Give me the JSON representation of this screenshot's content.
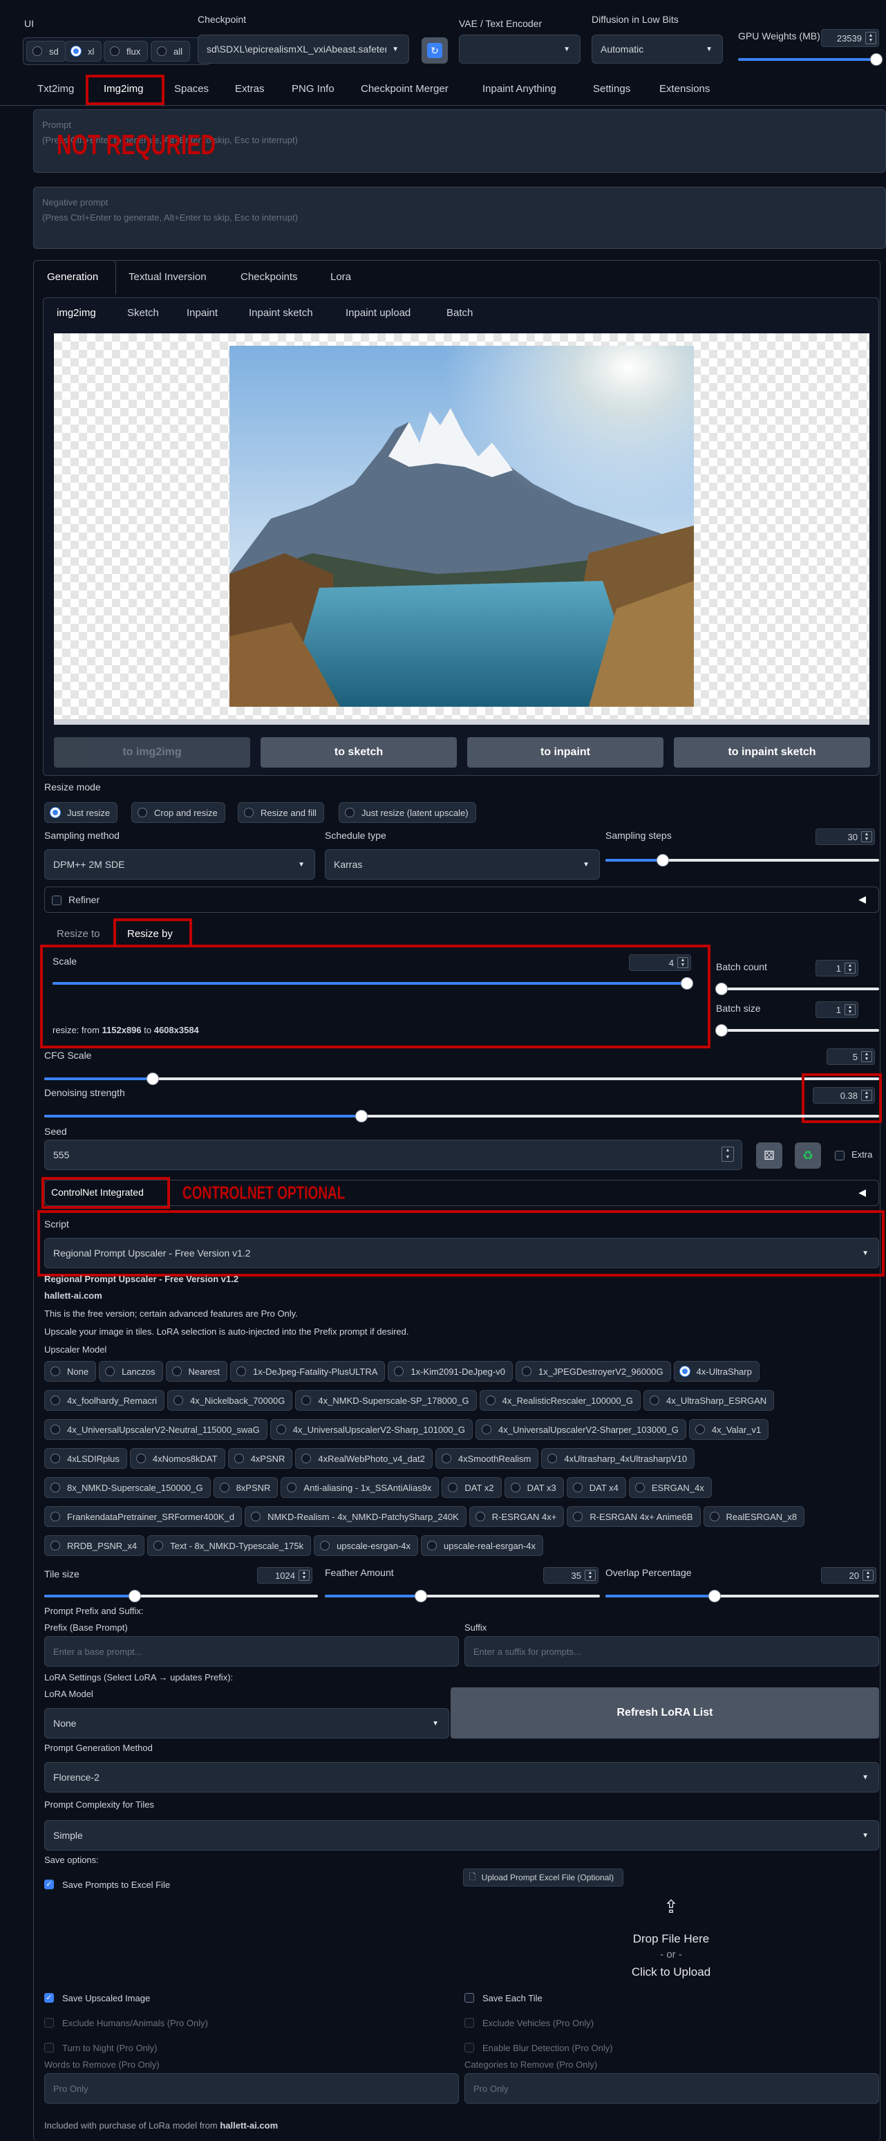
{
  "header": {
    "ui_label": "UI",
    "ui_options": [
      "sd",
      "xl",
      "flux",
      "all"
    ],
    "ui_selected": "xl",
    "checkpoint_label": "Checkpoint",
    "checkpoint_value": "sd\\SDXL\\epicrealismXL_vxiAbeast.safetensors",
    "vae_label": "VAE / Text Encoder",
    "vae_value": "",
    "diffusion_label": "Diffusion in Low Bits",
    "diffusion_value": "Automatic",
    "gpu_label": "GPU Weights (MB)",
    "gpu_value": "23539"
  },
  "main_tabs": [
    "Txt2img",
    "Img2img",
    "Spaces",
    "Extras",
    "PNG Info",
    "Checkpoint Merger",
    "Inpaint Anything",
    "Settings",
    "Extensions"
  ],
  "main_tab_active": "Img2img",
  "prompt": {
    "label": "Prompt",
    "placeholder": "(Press Ctrl+Enter to generate, Alt+Enter to skip, Esc to interrupt)"
  },
  "negative_prompt": {
    "label": "Negative prompt",
    "placeholder": "(Press Ctrl+Enter to generate, Alt+Enter to skip, Esc to interrupt)"
  },
  "gen_tabs": [
    "Generation",
    "Textual Inversion",
    "Checkpoints",
    "Lora"
  ],
  "img_tabs": [
    "img2img",
    "Sketch",
    "Inpaint",
    "Inpaint sketch",
    "Inpaint upload",
    "Batch"
  ],
  "send_buttons": [
    "to img2img",
    "to sketch",
    "to inpaint",
    "to inpaint sketch"
  ],
  "resize_mode": {
    "label": "Resize mode",
    "options": [
      "Just resize",
      "Crop and resize",
      "Resize and fill",
      "Just resize (latent upscale)"
    ],
    "selected": "Just resize"
  },
  "sampling": {
    "method_label": "Sampling method",
    "method_value": "DPM++ 2M SDE",
    "schedule_label": "Schedule type",
    "schedule_value": "Karras",
    "steps_label": "Sampling steps",
    "steps_value": "30"
  },
  "refiner_label": "Refiner",
  "resize_tabs": [
    "Resize to",
    "Resize by"
  ],
  "scale": {
    "label": "Scale",
    "value": "4",
    "info_prefix": "resize: from ",
    "from": "1152x896",
    "to_word": " to ",
    "to": "4608x3584",
    "level": 1.0
  },
  "batch_count": {
    "label": "Batch count",
    "value": "1"
  },
  "batch_size": {
    "label": "Batch size",
    "value": "1"
  },
  "cfg": {
    "label": "CFG Scale",
    "value": "5",
    "level": 0.13
  },
  "denoise": {
    "label": "Denoising strength",
    "value": "0.38",
    "level": 0.38
  },
  "seed": {
    "label": "Seed",
    "value": "555",
    "extra_label": "Extra"
  },
  "controlnet_label": "ControlNet Integrated",
  "script": {
    "label": "Script",
    "value": "Regional Prompt Upscaler - Free Version v1.2"
  },
  "rpu": {
    "title": "Regional Prompt Upscaler - Free Version v1.2",
    "site": "hallett-ai.com",
    "line1": "This is the free version; certain advanced features are Pro Only.",
    "line2": "Upscale your image in tiles. LoRA selection is auto-injected into the Prefix prompt if desired.",
    "upscaler_label": "Upscaler Model",
    "upscalers": [
      [
        "None",
        "Lanczos",
        "Nearest",
        "1x-DeJpeg-Fatality-PlusULTRA",
        "1x-Kim2091-DeJpeg-v0",
        "1x_JPEGDestroyerV2_96000G",
        "4x-UltraSharp"
      ],
      [
        "4x_foolhardy_Remacri",
        "4x_Nickelback_70000G",
        "4x_NMKD-Superscale-SP_178000_G",
        "4x_RealisticRescaler_100000_G",
        "4x_UltraSharp_ESRGAN"
      ],
      [
        "4x_UniversalUpscalerV2-Neutral_115000_swaG",
        "4x_UniversalUpscalerV2-Sharp_101000_G",
        "4x_UniversalUpscalerV2-Sharper_103000_G",
        "4x_Valar_v1"
      ],
      [
        "4xLSDIRplus",
        "4xNomos8kDAT",
        "4xPSNR",
        "4xRealWebPhoto_v4_dat2",
        "4xSmoothRealism",
        "4xUltrasharp_4xUltrasharpV10"
      ],
      [
        "8x_NMKD-Superscale_150000_G",
        "8xPSNR",
        "Anti-aliasing - 1x_SSAntiAlias9x",
        "DAT x2",
        "DAT x3",
        "DAT x4",
        "ESRGAN_4x"
      ],
      [
        "FrankendataPretrainer_SRFormer400K_d",
        "NMKD-Realism - 4x_NMKD-PatchySharp_240K",
        "R-ESRGAN 4x+",
        "R-ESRGAN 4x+ Anime6B",
        "RealESRGAN_x8"
      ],
      [
        "RRDB_PSNR_x4",
        "Text - 8x_NMKD-Typescale_175k",
        "upscale-esrgan-4x",
        "upscale-real-esrgan-4x"
      ]
    ],
    "upscaler_selected": "4x-UltraSharp",
    "tile_label": "Tile size",
    "tile_value": "1024",
    "tile_level": 0.33,
    "feather_label": "Feather Amount",
    "feather_value": "35",
    "feather_level": 0.35,
    "overlap_label": "Overlap Percentage",
    "overlap_value": "20",
    "overlap_level": 0.4,
    "prefix_suffix_label": "Prompt Prefix and Suffix:",
    "prefix_label": "Prefix (Base Prompt)",
    "prefix_placeholder": "Enter a base prompt...",
    "suffix_label": "Suffix",
    "suffix_placeholder": "Enter a suffix for prompts...",
    "lora_settings_label": "LoRA Settings (Select LoRA → updates Prefix):",
    "lora_model_label": "LoRA Model",
    "lora_model_value": "None",
    "refresh_lora": "Refresh LoRA List",
    "prompt_gen_label": "Prompt Generation Method",
    "prompt_gen_value": "Florence-2",
    "complexity_label": "Prompt Complexity for Tiles",
    "complexity_value": "Simple",
    "save_options_label": "Save options:",
    "save_excel_label": "Save Prompts to Excel File",
    "upload_excel_label": "Upload Prompt Excel File (Optional)",
    "drop_line1": "Drop File Here",
    "drop_line2": "- or -",
    "drop_line3": "Click to Upload",
    "save_upscaled": "Save Upscaled Image",
    "save_each_tile": "Save Each Tile",
    "exclude_humans": "Exclude Humans/Animals (Pro Only)",
    "exclude_vehicles": "Exclude Vehicles (Pro Only)",
    "turn_night": "Turn to Night (Pro Only)",
    "blur_detection": "Enable Blur Detection (Pro Only)",
    "words_remove_label": "Words to Remove (Pro Only)",
    "words_remove_placeholder": "Pro Only",
    "categories_remove_label": "Categories to Remove (Pro Only)",
    "categories_remove_placeholder": "Pro Only",
    "footer_prefix": "Included with purchase of LoRa model from ",
    "footer_link": "hallett-ai.com"
  },
  "annotations": {
    "not_required": "NOT REQURIED",
    "controlnet_optional": "CONTROLNET OPTIONAL"
  },
  "colors": {
    "accent": "#3b82f6",
    "annotation_red": "#c00000",
    "background": "#0b0f19"
  }
}
